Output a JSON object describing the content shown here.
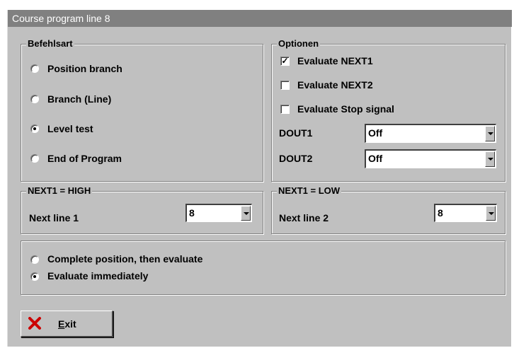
{
  "window": {
    "title": "Course program line 8"
  },
  "befehlsart": {
    "legend": "Befehlsart",
    "options": [
      {
        "label": "Position branch",
        "selected": false
      },
      {
        "label": "Branch (Line)",
        "selected": false
      },
      {
        "label": "Level test",
        "selected": true
      },
      {
        "label": "End of Program",
        "selected": false
      }
    ]
  },
  "optionen": {
    "legend": "Optionen",
    "checks": [
      {
        "label": "Evaluate NEXT1",
        "checked": true
      },
      {
        "label": "Evaluate NEXT2",
        "checked": false
      },
      {
        "label": "Evaluate Stop signal",
        "checked": false
      }
    ],
    "dout1": {
      "label": "DOUT1",
      "value": "Off"
    },
    "dout2": {
      "label": "DOUT2",
      "value": "Off"
    }
  },
  "next1_high": {
    "legend": "NEXT1 = HIGH",
    "label": "Next line 1",
    "value": "8"
  },
  "next1_low": {
    "legend": "NEXT1 = LOW",
    "label": "Next line 2",
    "value": "8"
  },
  "evaluation": {
    "options": [
      {
        "label": "Complete position, then evaluate",
        "selected": false
      },
      {
        "label": "Evaluate immediately",
        "selected": true
      }
    ]
  },
  "exit_button": {
    "label_first": "E",
    "label_rest": "xit",
    "icon": "x-icon",
    "icon_color": "#cc0000"
  }
}
